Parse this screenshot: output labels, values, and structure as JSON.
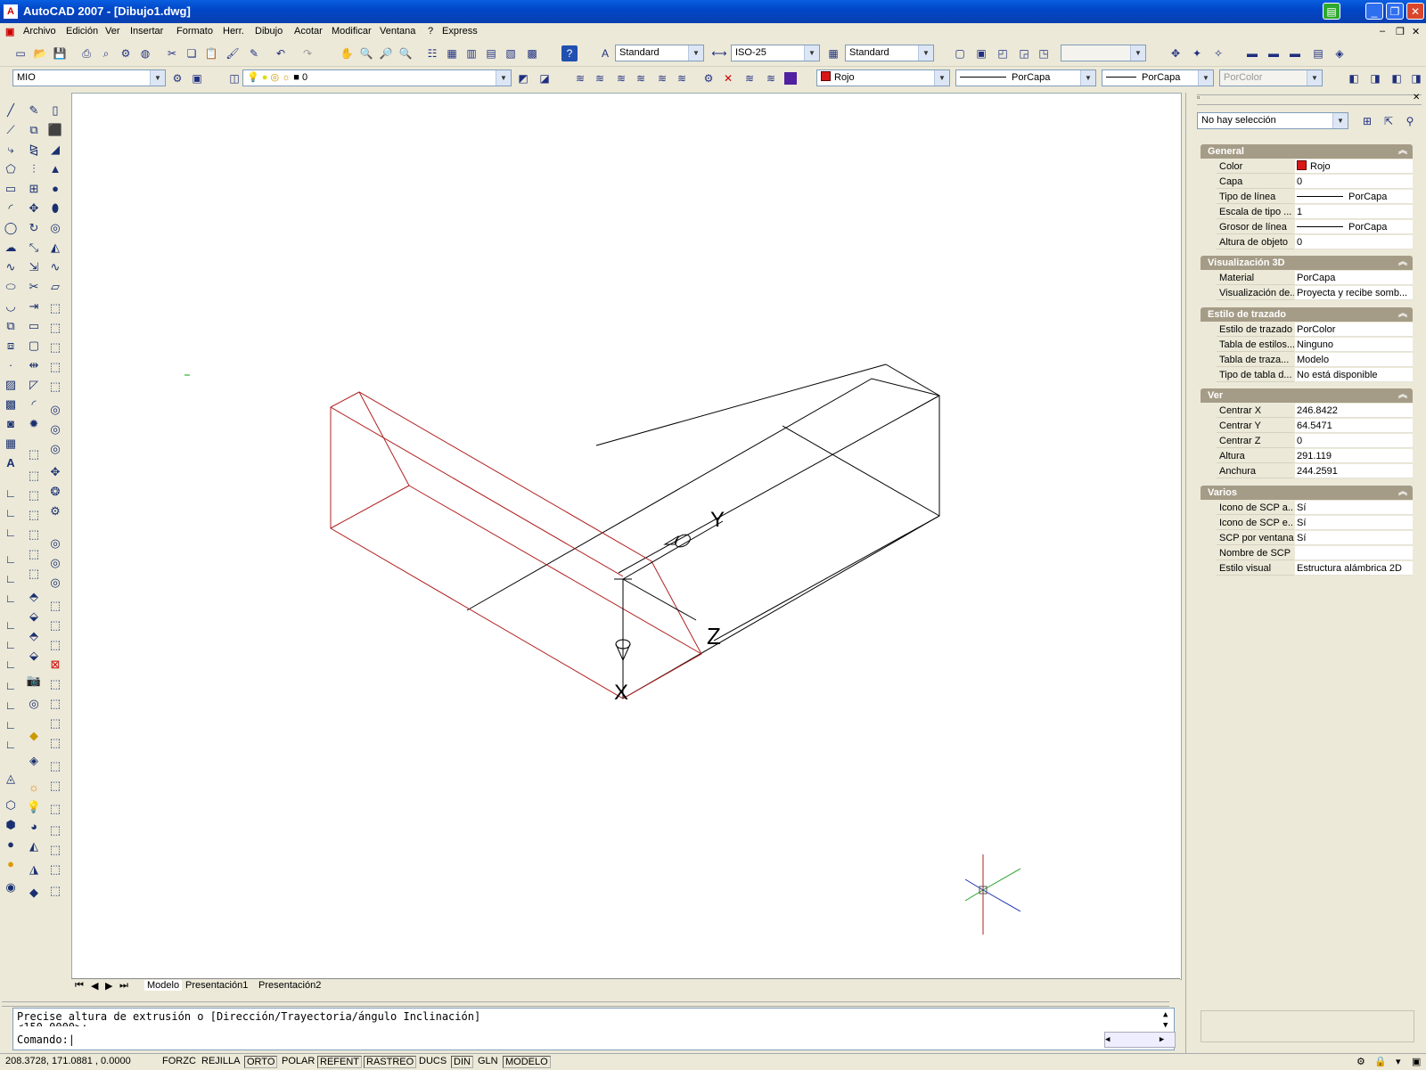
{
  "window": {
    "title": "AutoCAD 2007 - [Dibujo1.dwg]"
  },
  "menu": [
    "Archivo",
    "Edición",
    "Ver",
    "Insertar",
    "Formato",
    "Herr.",
    "Dibujo",
    "Acotar",
    "Modificar",
    "Ventana",
    "?",
    "Express"
  ],
  "toolbar1": {
    "text_style": "Standard",
    "dim_style": "ISO-25",
    "table_style": "Standard",
    "blank_combo": ""
  },
  "toolbar2": {
    "workspace": "MIO",
    "layer": "0",
    "color": "Rojo",
    "linetype": "PorCapa",
    "lineweight": "PorCapa",
    "plotstyle": "PorColor"
  },
  "tabs": [
    "Modelo",
    "Presentación1",
    "Presentación2"
  ],
  "command": {
    "line1": "Precise altura de extrusión o [Dirección/Trayectoria/ángulo Inclinación]",
    "line2": "<150.0000>:",
    "prompt": "Comando:"
  },
  "status": {
    "coords": "208.3728, 171.0881 , 0.0000",
    "toggles": [
      "FORZC",
      "REJILLA",
      "ORTO",
      "POLAR",
      "REFENT",
      "RASTREO",
      "DUCS",
      "DIN",
      "GLN",
      "MODELO"
    ]
  },
  "props": {
    "selection": "No hay selección",
    "sections": {
      "general": {
        "title": "General",
        "rows": [
          {
            "k": "Color",
            "v": "Rojo"
          },
          {
            "k": "Capa",
            "v": "0"
          },
          {
            "k": "Tipo de línea",
            "v": "PorCapa"
          },
          {
            "k": "Escala de tipo ...",
            "v": "1"
          },
          {
            "k": "Grosor de línea",
            "v": "PorCapa"
          },
          {
            "k": "Altura de objeto",
            "v": "0"
          }
        ]
      },
      "vis3d": {
        "title": "Visualización 3D",
        "rows": [
          {
            "k": "Material",
            "v": "PorCapa"
          },
          {
            "k": "Visualización de...",
            "v": "Proyecta y recibe somb..."
          }
        ]
      },
      "plot": {
        "title": "Estilo de trazado",
        "rows": [
          {
            "k": "Estilo de trazado",
            "v": "PorColor"
          },
          {
            "k": "Tabla de estilos...",
            "v": "Ninguno"
          },
          {
            "k": "Tabla de traza...",
            "v": "Modelo"
          },
          {
            "k": "Tipo de tabla d...",
            "v": "No está disponible"
          }
        ]
      },
      "view": {
        "title": "Ver",
        "rows": [
          {
            "k": "Centrar X",
            "v": "246.8422"
          },
          {
            "k": "Centrar Y",
            "v": "64.5471"
          },
          {
            "k": "Centrar Z",
            "v": "0"
          },
          {
            "k": "Altura",
            "v": "291.119"
          },
          {
            "k": "Anchura",
            "v": "244.2591"
          }
        ]
      },
      "misc": {
        "title": "Varios",
        "rows": [
          {
            "k": "Icono de SCP a...",
            "v": "Sí"
          },
          {
            "k": "Icono de SCP e...",
            "v": "Sí"
          },
          {
            "k": "SCP por ventana",
            "v": "Sí"
          },
          {
            "k": "Nombre de SCP",
            "v": ""
          },
          {
            "k": "Estilo visual",
            "v": "Estructura alámbrica 2D"
          }
        ]
      }
    }
  },
  "ucs_labels": {
    "y": "Y",
    "z": "Z",
    "x": "X"
  },
  "icons": {
    "app": "autocad-icon",
    "close": "close-icon",
    "minimize": "minimize-icon",
    "maximize": "restore-icon"
  }
}
